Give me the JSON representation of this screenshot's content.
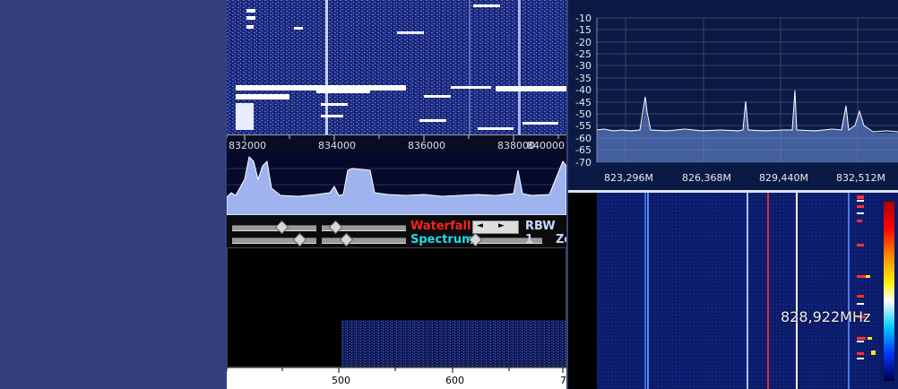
{
  "left_panel": {
    "freq_scale": [
      "832000",
      "834000",
      "836000",
      "838000",
      "840000"
    ],
    "controls": {
      "waterfall_label": "Waterfall",
      "spectrum_label": "Spectrum",
      "rbw_label": "RBW 1",
      "zoom_label": "Zo",
      "left_arrow": "◄",
      "right_arrow": "►"
    },
    "bottom_scale": [
      "500",
      "600",
      "7"
    ]
  },
  "right_panel": {
    "db_labels": [
      "-10",
      "-15",
      "-20",
      "-25",
      "-30",
      "-35",
      "-40",
      "-45",
      "-50",
      "-55",
      "-60",
      "-65",
      "-70"
    ],
    "freq_labels": [
      "823,296M",
      "826,368M",
      "829,440M",
      "832,512M"
    ],
    "frequency_readout": "828,922MHz"
  },
  "colors": {
    "background": "#33407c",
    "waterfall_label": "#ff2020",
    "spectrum_label": "#22d8e8",
    "rbw_label": "#c8d8ff"
  }
}
